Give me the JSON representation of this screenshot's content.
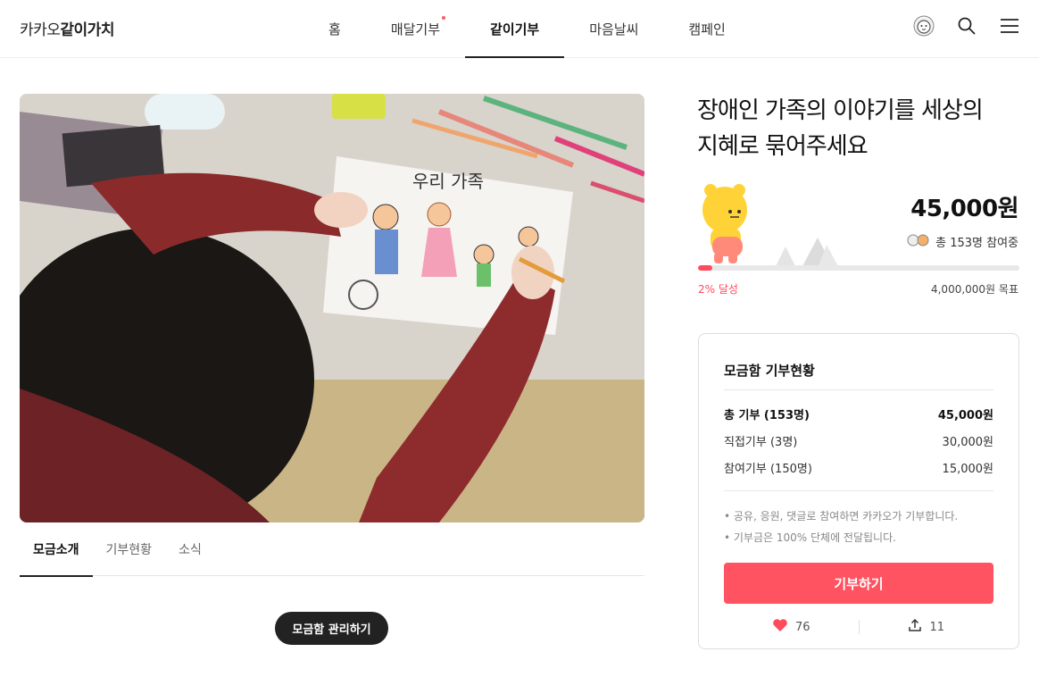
{
  "header": {
    "logo_light": "카카오",
    "logo_bold": "같이가치",
    "nav": [
      {
        "label": "홈"
      },
      {
        "label": "매달기부"
      },
      {
        "label": "같이기부"
      },
      {
        "label": "마음날씨"
      },
      {
        "label": "캠페인"
      }
    ],
    "active_nav": "같이기부"
  },
  "hero": {
    "drawing_caption": "우리 가족"
  },
  "tabs": [
    {
      "label": "모금소개"
    },
    {
      "label": "기부현황"
    },
    {
      "label": "소식"
    }
  ],
  "manage_button": "모금함 관리하기",
  "campaign": {
    "title_line1": "장애인 가족의 이야기를 세상의",
    "title_line2": "지혜로 묶어주세요",
    "amount": "45,000원",
    "participants": "총 153명 참여중",
    "progress_percent": 2,
    "percent_label": "2% 달성",
    "goal_label": "4,000,000원 목표"
  },
  "card": {
    "title": "모금함 기부현황",
    "rows": [
      {
        "label": "총 기부 (153명)",
        "value": "45,000원"
      },
      {
        "label": "직접기부 (3명)",
        "value": "30,000원"
      },
      {
        "label": "참여기부 (150명)",
        "value": "15,000원"
      }
    ],
    "notes": [
      "• 공유, 응원, 댓글로 참여하면 카카오가 기부합니다.",
      "• 기부금은 100% 단체에 전달됩니다."
    ],
    "donate_label": "기부하기",
    "likes": "76",
    "shares": "11"
  },
  "colors": {
    "accent": "#ff5361",
    "progress": "#ff4b5c",
    "dark": "#222222"
  }
}
